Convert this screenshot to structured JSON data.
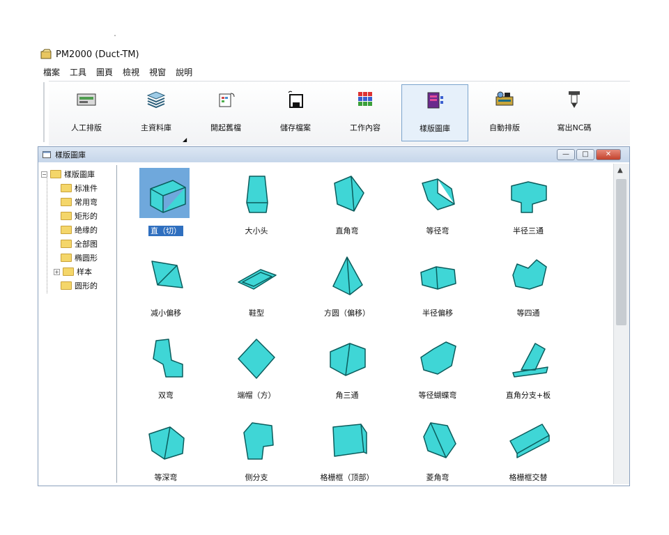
{
  "app": {
    "title": "PM2000 (Duct-TM)"
  },
  "menu": [
    "檔案",
    "工具",
    "圖頁",
    "檢視",
    "視窗",
    "說明"
  ],
  "toolbar": [
    {
      "label": "人工排版",
      "icon": "manual-nesting-icon"
    },
    {
      "label": "主資料庫",
      "icon": "database-icon"
    },
    {
      "label": "開起舊檔",
      "icon": "open-file-icon"
    },
    {
      "label": "儲存檔案",
      "icon": "save-icon"
    },
    {
      "label": "工作內容",
      "icon": "grid-icon"
    },
    {
      "label": "樣版圖庫",
      "icon": "template-library-icon"
    },
    {
      "label": "自動排版",
      "icon": "auto-nesting-icon"
    },
    {
      "label": "寫出NC碼",
      "icon": "nc-tool-icon"
    }
  ],
  "child_window": {
    "title": "樣版圖庫",
    "buttons": [
      "—",
      "□",
      "✕"
    ]
  },
  "tree": {
    "root": "樣版圖庫",
    "items": [
      "标准件",
      "常用弯",
      "矩形的",
      "绝缘的",
      "全部图",
      "椭圆形",
      "样本",
      "圆形的"
    ]
  },
  "gallery": [
    {
      "label": "直（切）",
      "selected": true
    },
    {
      "label": "大小头"
    },
    {
      "label": "直角弯"
    },
    {
      "label": "等径弯"
    },
    {
      "label": "半径三通"
    },
    {
      "label": "减小偏移"
    },
    {
      "label": "鞋型"
    },
    {
      "label": "方圆（偏移）"
    },
    {
      "label": "半径偏移"
    },
    {
      "label": "等四通"
    },
    {
      "label": "双弯"
    },
    {
      "label": "端帽（方）"
    },
    {
      "label": "角三通"
    },
    {
      "label": "等径蝴蝶弯"
    },
    {
      "label": "直角分支+板"
    },
    {
      "label": "等深弯"
    },
    {
      "label": "侧分支"
    },
    {
      "label": "格栅框（顶部）"
    },
    {
      "label": "菱角弯"
    },
    {
      "label": "格栅框交替"
    }
  ],
  "colors": {
    "shape_fill": "#3fd6d6",
    "shape_stroke": "#0b5c5c",
    "selection": "#2f6fbf",
    "titlebar": "#c6d6ea"
  }
}
